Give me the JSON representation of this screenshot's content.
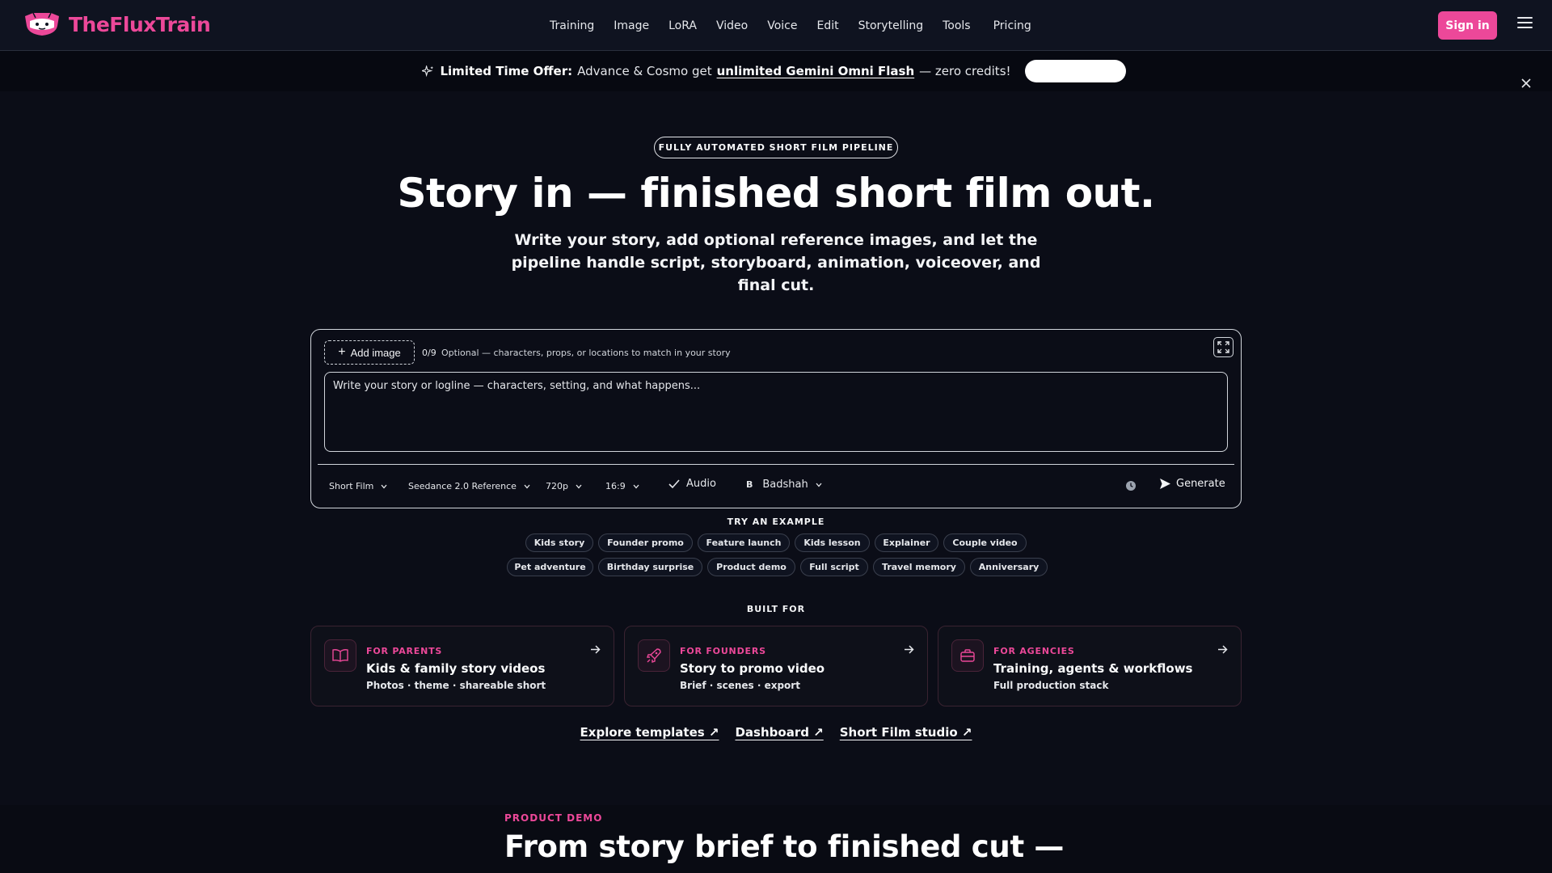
{
  "nav": {
    "brand": "TheFluxTrain",
    "links": [
      "Training",
      "Image",
      "LoRA",
      "Video",
      "Voice",
      "Edit",
      "Storytelling",
      "Tools",
      "Pricing"
    ],
    "signin_label": "Sign in"
  },
  "promo": {
    "strong": "Limited Time Offer:",
    "text_before": "Advance & Cosmo get",
    "link": "unlimited Gemini Omni Flash",
    "text_after": "— zero credits!"
  },
  "hero": {
    "badge": "FULLY AUTOMATED SHORT FILM PIPELINE",
    "title": "Story in — finished short film out.",
    "subtitle": "Write your story, add optional reference images, and let the pipeline handle script, storyboard, animation, voiceover, and final cut."
  },
  "composer": {
    "add_image_label": "Add image",
    "image_count": "0/9",
    "image_hint": "Optional — characters, props, or locations to match in your story",
    "story_placeholder": "Write your story or logline — characters, setting, and what happens...",
    "format": "Short Film",
    "model": "Seedance 2.0 Reference",
    "resolution": "720p",
    "aspect": "16:9",
    "audio_label": "Audio",
    "voice_initial": "B",
    "voice": "Badshah",
    "generate_label": "Generate"
  },
  "examples": {
    "label": "TRY AN EXAMPLE",
    "row1": [
      "Kids story",
      "Founder promo",
      "Feature launch",
      "Kids lesson",
      "Explainer",
      "Couple video"
    ],
    "row2": [
      "Pet adventure",
      "Birthday surprise",
      "Product demo",
      "Full script",
      "Travel memory",
      "Anniversary"
    ]
  },
  "built_for": {
    "label": "BUILT FOR",
    "cards": [
      {
        "eyebrow": "FOR PARENTS",
        "title": "Kids & family story videos",
        "sub": "Photos · theme · shareable short",
        "icon": "book-icon"
      },
      {
        "eyebrow": "FOR FOUNDERS",
        "title": "Story to promo video",
        "sub": "Brief · scenes · export",
        "icon": "rocket-icon"
      },
      {
        "eyebrow": "FOR AGENCIES",
        "title": "Training, agents & workflows",
        "sub": "Full production stack",
        "icon": "briefcase-icon"
      }
    ]
  },
  "links": [
    "Explore templates ↗",
    "Dashboard ↗",
    "Short Film studio ↗"
  ],
  "demo": {
    "eyebrow": "PRODUCT DEMO",
    "title": "From story brief to finished cut —"
  },
  "colors": {
    "accent": "#ec4899",
    "background": "#0b0d17"
  }
}
